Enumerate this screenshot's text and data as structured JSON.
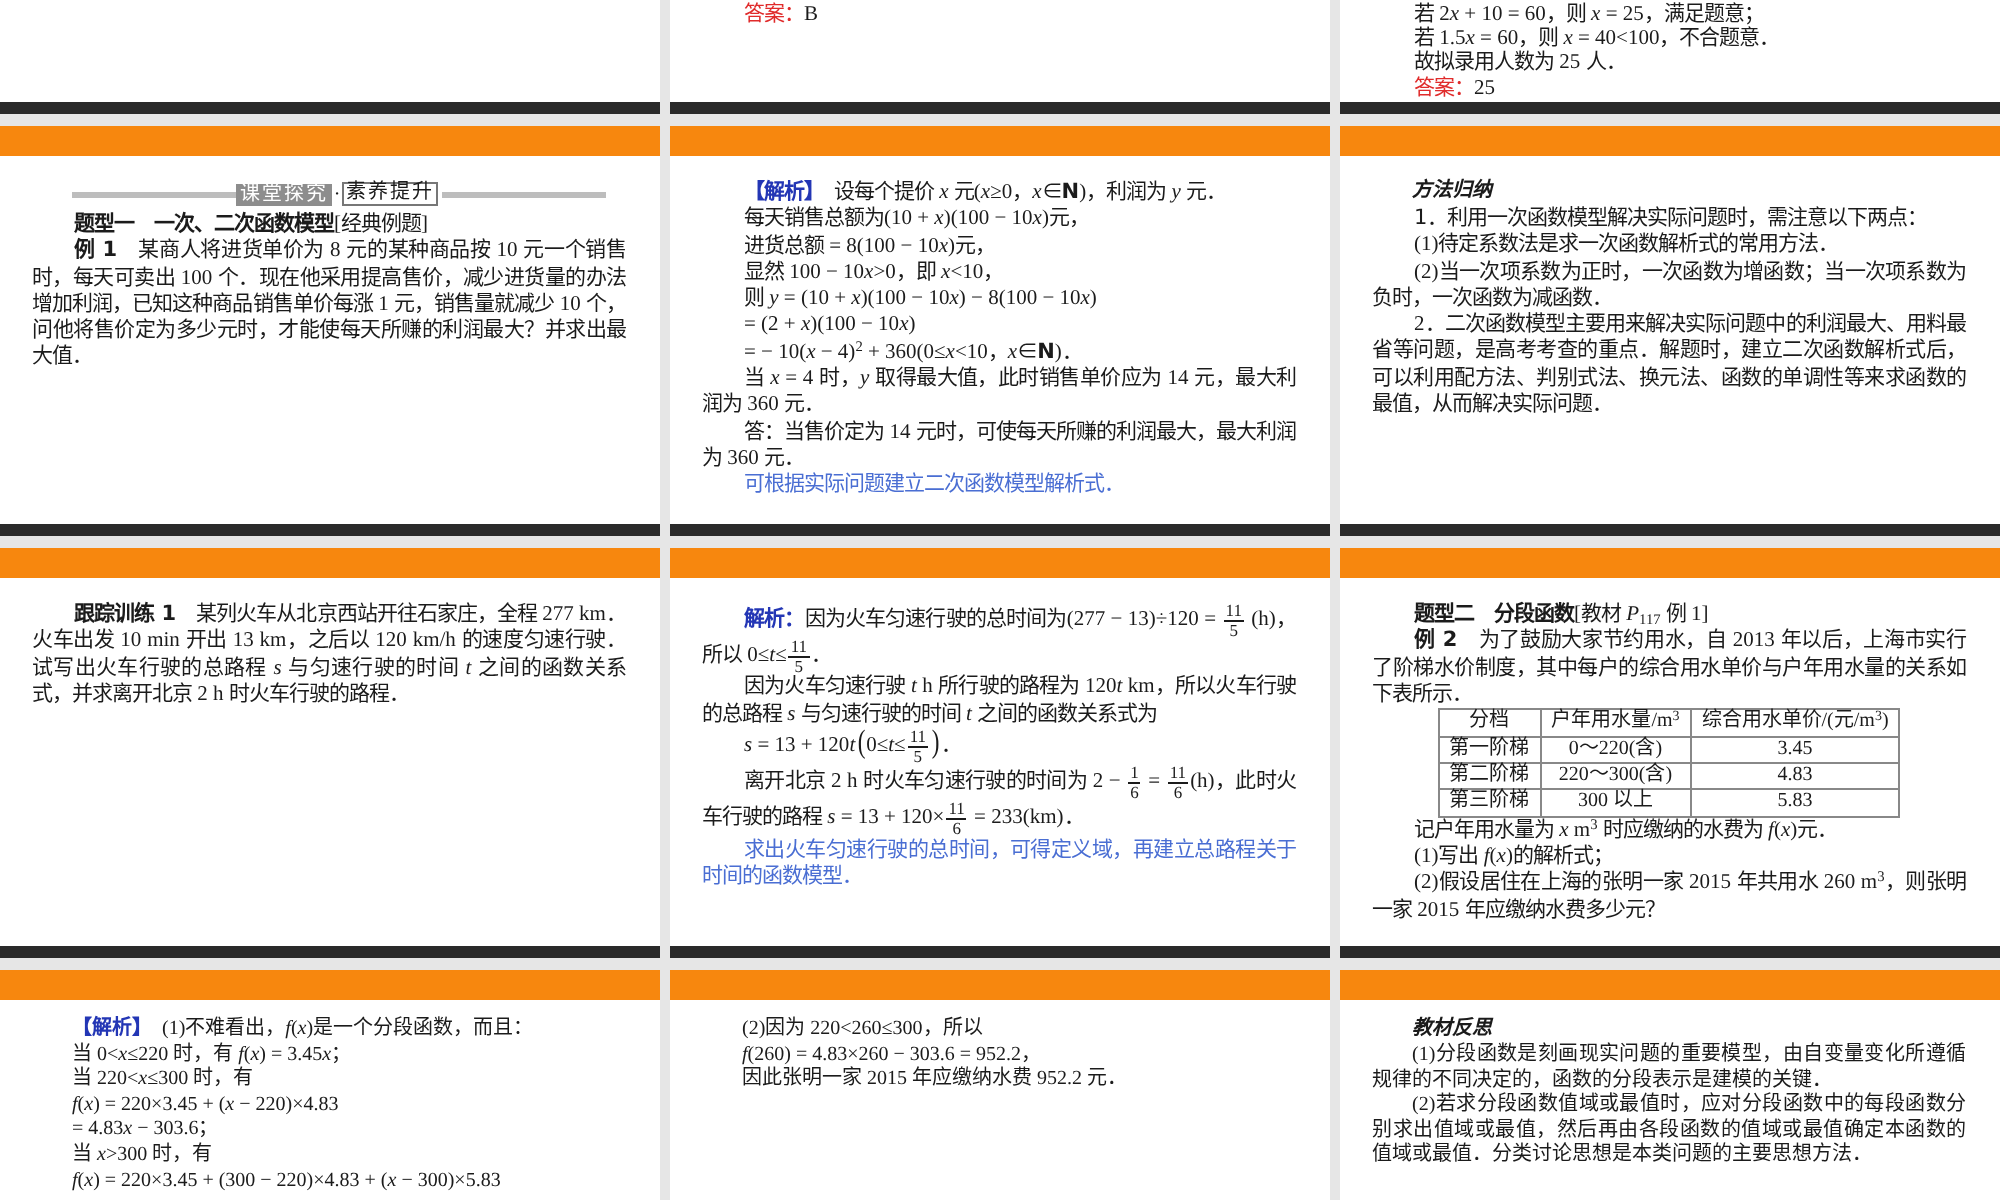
{
  "slides": [
    {
      "blocks": [
        {
          "kind": "answer",
          "label": "答案：",
          "value": "B"
        }
      ]
    },
    {
      "blocks": [
        {
          "kind": "paragraph",
          "parts": [
            {
              "kind": "text",
              "text": "若 2"
            },
            {
              "kind": "text",
              "text": "*x*"
            },
            {
              "kind": "text",
              "text": " + 10 = 60，则 *x* = 25，满足题意；"
            }
          ]
        },
        {
          "kind": "paragraph",
          "parts": [
            {
              "kind": "text",
              "text": "若 1.5"
            },
            {
              "kind": "text",
              "text": "*x*"
            },
            {
              "kind": "text",
              "text": " = 60，则 *x* = 40<100，不合题意．"
            }
          ]
        },
        {
          "kind": "paragraph",
          "text": "故拟录用人数为 25 人．"
        },
        {
          "kind": "answer",
          "label": "答案：",
          "value": "25"
        }
      ]
    },
    {
      "blocks": [
        {
          "kind": "banner",
          "label": "课堂探究",
          "separator": "·",
          "sublabel": "素养提升"
        },
        {
          "kind": "heading",
          "text": "**题型一　一次、二次函数模型**[经典例题]"
        },
        {
          "kind": "paragraph",
          "text": "**例 1**　某商人将进货单价为 8 元的某种商品按 10 元一个销售时，每天可卖出 100 个．现在他采用提高售价，减少进货量的办法增加利润，已知这种商品销售单价每涨 1 元，销售量就减少 10 个，问他将售价定为多少元时，才能使每天所赚的利润最大？并求出最大值．"
        }
      ]
    },
    {
      "blocks": [
        {
          "kind": "paragraph",
          "tag": "【解析】",
          "text": "　设每个提价 *x* 元(*x*≥0，*x*∈**N**)，利润为 *y* 元．"
        },
        {
          "kind": "paragraph",
          "parts": [
            {
              "kind": "text",
              "text": "每天销售总额为(10 + *x*)(100 − 10"
            },
            {
              "kind": "text",
              "text": "*x*"
            },
            {
              "kind": "text",
              "text": ")元，"
            }
          ]
        },
        {
          "kind": "paragraph",
          "parts": [
            {
              "kind": "text",
              "text": "进货总额 = 8(100 − 10"
            },
            {
              "kind": "text",
              "text": "*x*"
            },
            {
              "kind": "text",
              "text": ")元，"
            }
          ]
        },
        {
          "kind": "paragraph",
          "parts": [
            {
              "kind": "text",
              "text": "显然 100 − 10"
            },
            {
              "kind": "text",
              "text": "*x*"
            },
            {
              "kind": "text",
              "text": ">0，即 *x*<10，"
            }
          ]
        },
        {
          "kind": "paragraph",
          "parts": [
            {
              "kind": "text",
              "text": "则 *y* = (10 + *x*)(100 − 10"
            },
            {
              "kind": "text",
              "text": "*x*"
            },
            {
              "kind": "text",
              "text": ") − 8(100 − 10"
            },
            {
              "kind": "text",
              "text": "*x*"
            },
            {
              "kind": "text",
              "text": ")"
            }
          ]
        },
        {
          "kind": "paragraph",
          "parts": [
            {
              "kind": "text",
              "text": "= (2 + *x*)(100 − 10"
            },
            {
              "kind": "text",
              "text": "*x*"
            },
            {
              "kind": "text",
              "text": ")"
            }
          ]
        },
        {
          "kind": "paragraph",
          "text": "= − 10(*x* − 4)$^{2}$ + 360(0≤*x*<10，*x*∈**N**)．"
        },
        {
          "kind": "paragraph",
          "text": "当 *x* = 4 时，*y* 取得最大值，此时销售单价应为 14 元，最大利润为 360 元．"
        },
        {
          "kind": "paragraph",
          "text": "答：当售价定为 14 元时，可使每天所赚的利润最大，最大利润为 360 元．"
        },
        {
          "kind": "note",
          "text": "可根据实际问题建立二次函数模型解析式．"
        }
      ]
    },
    {
      "blocks": [
        {
          "kind": "caption",
          "text": "方法归纳"
        },
        {
          "kind": "subheading",
          "text": "1．利用一次函数模型解决实际问题时，需注意以下两点："
        },
        {
          "kind": "paragraph",
          "text": "(1)待定系数法是求一次函数解析式的常用方法．"
        },
        {
          "kind": "paragraph",
          "text": "(2)当一次项系数为正时，一次函数为增函数；当一次项系数为负时，一次函数为减函数．"
        },
        {
          "kind": "paragraph",
          "text": "2．二次函数模型主要用来解决实际问题中的利润最大、用料最省等问题，是高考考查的重点．解题时，建立二次函数解析式后，可以利用配方法、判别式法、换元法、函数的单调性等来求函数的最值，从而解决实际问题．"
        }
      ]
    },
    {
      "blocks": [
        {
          "kind": "paragraph",
          "text": "**跟踪训练 1**　某列火车从北京西站开往石家庄，全程 277 km．火车出发 10 min 开出 13 km，之后以 120 km/h 的速度匀速行驶．试写出火车行驶的总路程 *s* 与匀速行驶的时间 *t* 之间的函数关系式，并求离开北京 2 h 时火车行驶的路程．"
        }
      ]
    },
    {
      "blocks": [
        {
          "kind": "paragraph",
          "tag": "解析：",
          "parts": [
            {
              "kind": "text",
              "text": "因为火车匀速行驶的总时间为(277 − 13)÷120 = "
            },
            {
              "kind": "fraction",
              "numerator": "11",
              "denominator": "5"
            },
            {
              "kind": "text",
              "text": " (h)，所以 0≤*t*≤"
            },
            {
              "kind": "fraction",
              "numerator": "11",
              "denominator": "5"
            },
            {
              "kind": "text",
              "text": "．"
            }
          ]
        },
        {
          "kind": "paragraph",
          "parts": [
            {
              "kind": "text",
              "text": "因为火车匀速行驶 *t* h 所行驶的路程为 120"
            },
            {
              "kind": "text",
              "text": "*t*"
            },
            {
              "kind": "text",
              "text": " km，所以火车行驶的总路程 *s* 与匀速行驶的时间 *t* 之间的函数关系式为"
            }
          ]
        },
        {
          "kind": "paragraph",
          "parts": [
            {
              "kind": "text",
              "text": "*s* = 13 + 120"
            },
            {
              "kind": "text",
              "text": "*t*"
            },
            {
              "kind": "bracket",
              "open": "(",
              "close": ")",
              "parts": [
                {
                  "kind": "text",
                  "text": "0≤*t*≤"
                },
                {
                  "kind": "fraction",
                  "numerator": "11",
                  "denominator": "5"
                }
              ]
            },
            {
              "kind": "text",
              "text": "．"
            }
          ]
        },
        {
          "kind": "paragraph",
          "parts": [
            {
              "kind": "text",
              "text": "离开北京 2 h 时火车匀速行驶的时间为 2 − "
            },
            {
              "kind": "fraction",
              "numerator": "1",
              "denominator": "6"
            },
            {
              "kind": "text",
              "text": " = "
            },
            {
              "kind": "fraction",
              "numerator": "11",
              "denominator": "6"
            },
            {
              "kind": "text",
              "text": "(h)，此时火车行驶的路程 *s* = 13 + 120×"
            },
            {
              "kind": "fraction",
              "numerator": "11",
              "denominator": "6"
            },
            {
              "kind": "text",
              "text": " = 233(km)．"
            }
          ]
        },
        {
          "kind": "note",
          "text": "求出火车匀速行驶的总时间，可得定义域，再建立总路程关于时间的函数模型．"
        }
      ]
    },
    {
      "blocks": [
        {
          "kind": "heading",
          "text": "**题型二　分段函数**[教材 *P*$_{117}$ 例 1]"
        },
        {
          "kind": "paragraph",
          "text": "**例 2**　为了鼓励大家节约用水，自 2013 年以后，上海市实行了阶梯水价制度，其中每户的综合用水单价与户年用水量的关系如下表所示．"
        },
        {
          "kind": "table",
          "columns": [
            "分档",
            "户年用水量/m$^{3}$",
            "综合用水单价/(元/m$^{3}$)"
          ],
          "rows": [
            [
              "第一阶梯",
              "0～220(含)",
              "3.45"
            ],
            [
              "第二阶梯",
              "220～300(含)",
              "4.83"
            ],
            [
              "第三阶梯",
              "300 以上",
              "5.83"
            ]
          ]
        },
        {
          "kind": "paragraph",
          "text": "记户年用水量为 *x* m$^{3}$ 时应缴纳的水费为 *f*(*x*)元．"
        },
        {
          "kind": "paragraph",
          "text": "(1)写出 *f*(*x*)的解析式；"
        },
        {
          "kind": "paragraph",
          "text": "(2)假设居住在上海的张明一家 2015 年共用水 260 m$^{3}$，则张明一家 2015 年应缴纳水费多少元？"
        }
      ]
    },
    {
      "blocks": [
        {
          "kind": "paragraph",
          "tag": "【解析】",
          "text": "　(1)不难看出，*f*(*x*)是一个分段函数，而且："
        },
        {
          "kind": "paragraph",
          "parts": [
            {
              "kind": "text",
              "text": "当 0<*x*≤220 时，有 *f*(*x*) = 3.45"
            },
            {
              "kind": "text",
              "text": "*x*"
            },
            {
              "kind": "text",
              "text": "；"
            }
          ]
        },
        {
          "kind": "paragraph",
          "text": "当 220<*x*≤300 时，有"
        },
        {
          "kind": "paragraph",
          "text": "*f*(*x*) = 220×3.45 + (*x* − 220)×4.83"
        },
        {
          "kind": "paragraph",
          "parts": [
            {
              "kind": "text",
              "text": "= 4.83"
            },
            {
              "kind": "text",
              "text": "*x*"
            },
            {
              "kind": "text",
              "text": " − 303.6；"
            }
          ]
        },
        {
          "kind": "paragraph",
          "text": "当 *x*>300 时，有"
        },
        {
          "kind": "paragraph",
          "text": "*f*(*x*) = 220×3.45 + (300 − 220)×4.83 + (*x* − 300)×5.83"
        }
      ]
    },
    {
      "blocks": [
        {
          "kind": "paragraph",
          "text": "(2)因为 220<260≤300，所以"
        },
        {
          "kind": "paragraph",
          "text": "*f*(260) = 4.83×260 − 303.6 = 952.2，"
        },
        {
          "kind": "paragraph",
          "text": "因此张明一家 2015 年应缴纳水费 952.2 元．"
        }
      ]
    },
    {
      "blocks": [
        {
          "kind": "caption",
          "text": "教材反思"
        },
        {
          "kind": "paragraph",
          "text": "(1)分段函数是刻画现实问题的重要模型，由自变量变化所遵循规律的不同决定的，函数的分段表示是建模的关键．"
        },
        {
          "kind": "paragraph",
          "text": "(2)若求分段函数值域或最值时，应对分段函数中的每段函数分别求出值域或最值，然后再由各段函数的值域或最值确定本函数的值域或最值．分类讨论思想是本类问题的主要思想方法．"
        }
      ]
    }
  ]
}
